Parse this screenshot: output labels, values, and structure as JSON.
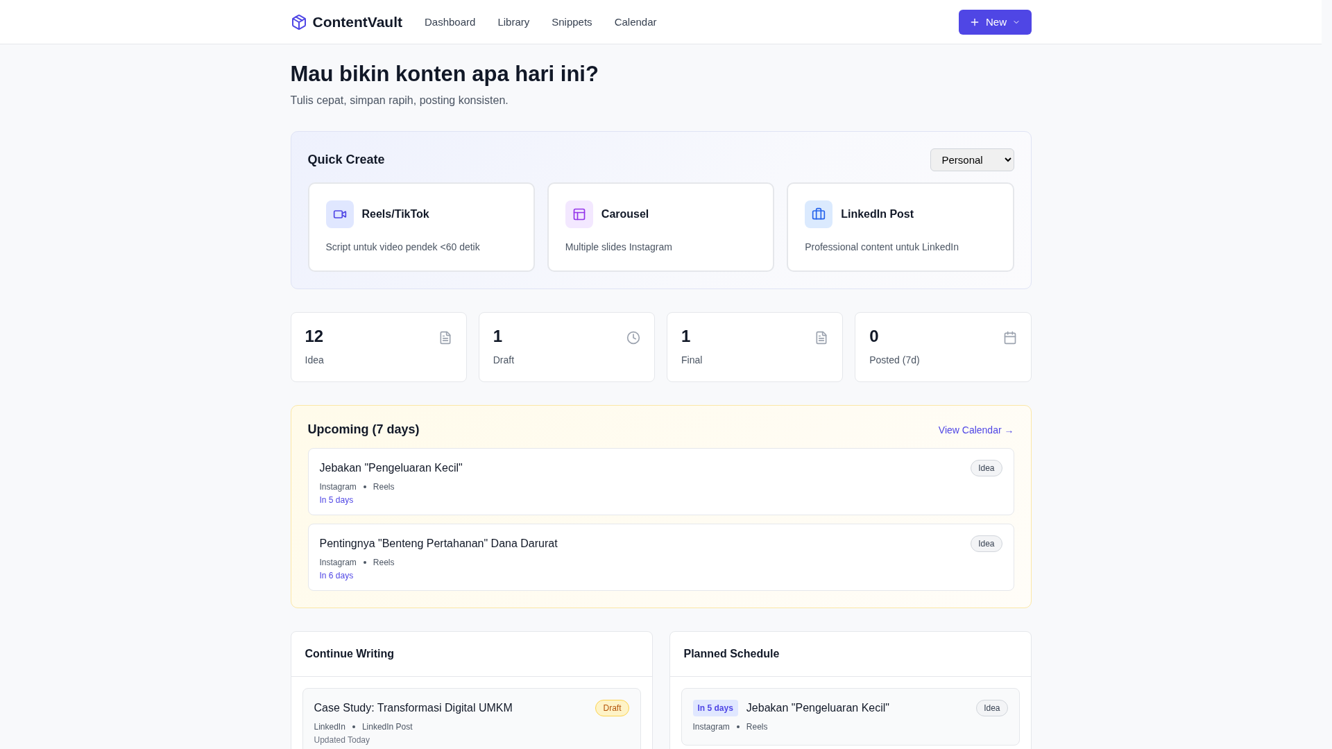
{
  "header": {
    "logo": "ContentVault",
    "nav": [
      {
        "label": "Dashboard"
      },
      {
        "label": "Library"
      },
      {
        "label": "Snippets"
      },
      {
        "label": "Calendar"
      }
    ],
    "new_button": "New"
  },
  "hero": {
    "title": "Mau bikin konten apa hari ini?",
    "subtitle": "Tulis cepat, simpan rapih, posting konsisten."
  },
  "quick_create": {
    "title": "Quick Create",
    "account": "Personal",
    "cards": [
      {
        "title": "Reels/TikTok",
        "description": "Script untuk video pendek <60 detik"
      },
      {
        "title": "Carousel",
        "description": "Multiple slides Instagram"
      },
      {
        "title": "LinkedIn Post",
        "description": "Professional content untuk LinkedIn"
      }
    ]
  },
  "stats": [
    {
      "value": "12",
      "label": "Idea"
    },
    {
      "value": "1",
      "label": "Draft"
    },
    {
      "value": "1",
      "label": "Final"
    },
    {
      "value": "0",
      "label": "Posted (7d)"
    }
  ],
  "upcoming": {
    "title": "Upcoming (7 days)",
    "link": "View Calendar →",
    "items": [
      {
        "title": "Jebakan \"Pengeluaran Kecil\"",
        "platform": "Instagram",
        "format": "Reels",
        "when": "In 5 days",
        "status": "Idea",
        "kind": "idea"
      },
      {
        "title": "Pentingnya \"Benteng Pertahanan\" Dana Darurat",
        "platform": "Instagram",
        "format": "Reels",
        "when": "In 6 days",
        "status": "Idea",
        "kind": "idea"
      }
    ]
  },
  "continue_writing": {
    "title": "Continue Writing",
    "items": [
      {
        "title": "Case Study: Transformasi Digital UMKM",
        "platform": "LinkedIn",
        "format": "LinkedIn Post",
        "updated": "Updated Today",
        "status": "Draft",
        "kind": "draft"
      }
    ]
  },
  "planned_schedule": {
    "title": "Planned Schedule",
    "items": [
      {
        "when": "In 5 days",
        "title": "Jebakan \"Pengeluaran Kecil\"",
        "platform": "Instagram",
        "format": "Reels",
        "status": "Idea",
        "kind": "idea"
      }
    ]
  }
}
